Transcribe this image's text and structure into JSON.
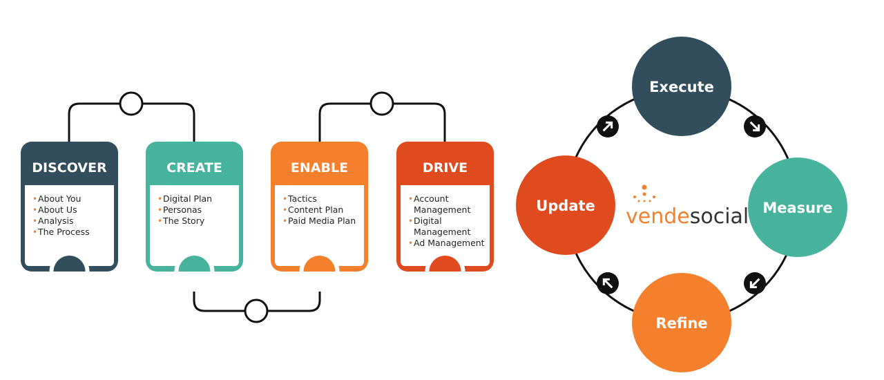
{
  "colors": {
    "discover": "#324d5c",
    "create": "#48b39d",
    "enable": "#f47f2c",
    "drive": "#e04a1f",
    "line": "#111111",
    "bullet": "#f47f2c"
  },
  "cards": [
    {
      "title": "DISCOVER",
      "color": "#324d5c",
      "items": [
        "About You",
        "About Us",
        "Analysis",
        "The Process"
      ]
    },
    {
      "title": "CREATE",
      "color": "#48b39d",
      "items": [
        "Digital Plan",
        "Personas",
        "The Story"
      ]
    },
    {
      "title": "ENABLE",
      "color": "#f47f2c",
      "items": [
        "Tactics",
        "Content Plan",
        "Paid Media Plan"
      ]
    },
    {
      "title": "DRIVE",
      "color": "#e04a1f",
      "items": [
        "Account",
        "Management",
        "Digital",
        "Management",
        "Ad Management"
      ],
      "bulleted": [
        true,
        false,
        true,
        false,
        true
      ]
    }
  ],
  "cycle": [
    {
      "label": "Execute",
      "color": "#324d5c"
    },
    {
      "label": "Measure",
      "color": "#48b39d"
    },
    {
      "label": "Refine",
      "color": "#f47f2c"
    },
    {
      "label": "Update",
      "color": "#e04a1f"
    }
  ],
  "arrow_icons": [
    "arrow-up-right-icon",
    "arrow-down-right-icon",
    "arrow-down-left-icon",
    "arrow-up-left-icon"
  ],
  "logo": {
    "part1": "vende",
    "part2": "social",
    "part1_color": "#f47f2c",
    "part2_color": "#333333"
  }
}
